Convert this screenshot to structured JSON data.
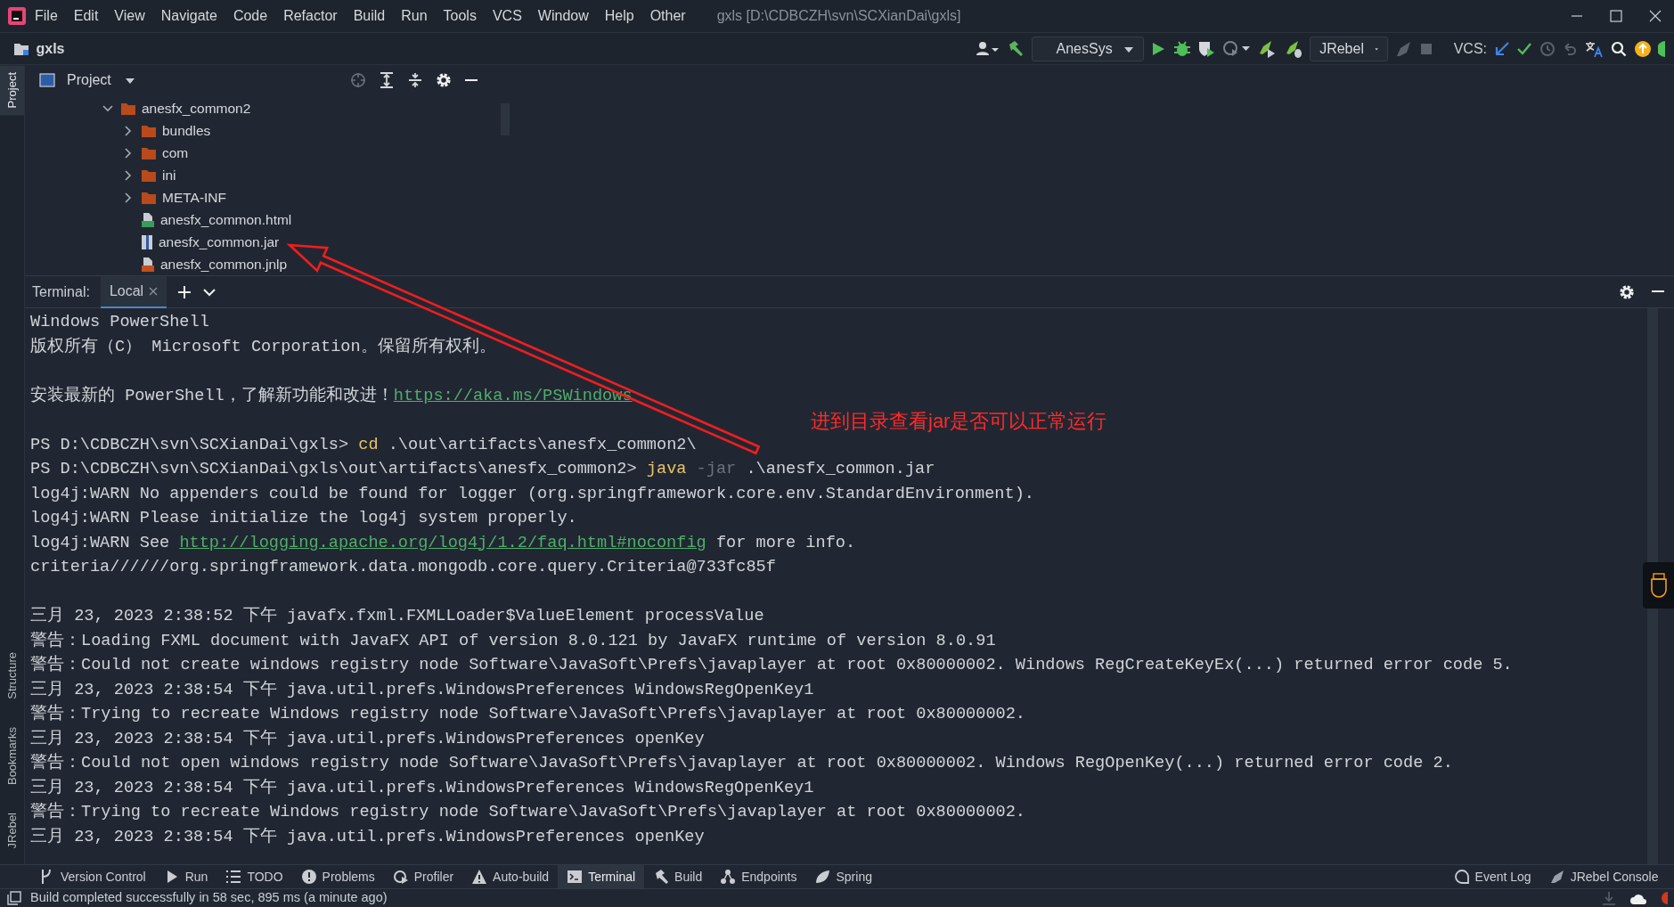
{
  "window": {
    "title": "gxls [D:\\CDBCZH\\svn\\SCXianDai\\gxls]"
  },
  "menu": [
    "File",
    "Edit",
    "View",
    "Navigate",
    "Code",
    "Refactor",
    "Build",
    "Run",
    "Tools",
    "VCS",
    "Window",
    "Help",
    "Other"
  ],
  "toolbar": {
    "project": "gxls",
    "run_config": "AnesSys",
    "jrebel_config": "JRebel",
    "vcs_label": "VCS:"
  },
  "side_tabs_top": [
    {
      "label": "Project",
      "selected": true
    }
  ],
  "side_tabs_bottom": [
    {
      "label": "Structure",
      "selected": false
    },
    {
      "label": "Bookmarks",
      "selected": false
    },
    {
      "label": "JRebel",
      "selected": false
    }
  ],
  "project_panel": {
    "title": "Project",
    "tree": [
      {
        "label": "anesfx_common2",
        "kind": "folder",
        "expanded": true,
        "children": [
          {
            "label": "bundles",
            "kind": "folder",
            "expanded": false
          },
          {
            "label": "com",
            "kind": "folder",
            "expanded": false
          },
          {
            "label": "ini",
            "kind": "folder",
            "expanded": false
          },
          {
            "label": "META-INF",
            "kind": "folder",
            "expanded": false
          },
          {
            "label": "anesfx_common.html",
            "kind": "html"
          },
          {
            "label": "anesfx_common.jar",
            "kind": "jar"
          },
          {
            "label": "anesfx_common.jnlp",
            "kind": "jnlp"
          }
        ]
      }
    ]
  },
  "terminal": {
    "label": "Terminal:",
    "tabs": [
      {
        "label": "Local",
        "selected": true
      }
    ],
    "lines": [
      {
        "segments": [
          {
            "text": "Windows PowerShell",
            "kind": "plain"
          }
        ]
      },
      {
        "segments": [
          {
            "text": "版权所有（C） Microsoft Corporation。保留所有权利。",
            "kind": "plain"
          }
        ]
      },
      {
        "blank_before": true,
        "segments": [
          {
            "text": "安装最新的 PowerShell，了解新功能和改进！",
            "kind": "plain"
          },
          {
            "text": "https://aka.ms/PSWindows",
            "kind": "link"
          }
        ]
      },
      {
        "blank_before": true,
        "segments": [
          {
            "text": "PS D:\\CDBCZH\\svn\\SCXianDai\\gxls> ",
            "kind": "plain"
          },
          {
            "text": "cd",
            "kind": "command"
          },
          {
            "text": " .\\out\\artifacts\\anesfx_common2\\",
            "kind": "plain"
          }
        ]
      },
      {
        "segments": [
          {
            "text": "PS D:\\CDBCZH\\svn\\SCXianDai\\gxls\\out\\artifacts\\anesfx_common2> ",
            "kind": "plain"
          },
          {
            "text": "java",
            "kind": "command"
          },
          {
            "text": " -jar",
            "kind": "flag"
          },
          {
            "text": " .\\anesfx_common.jar",
            "kind": "plain"
          }
        ]
      },
      {
        "segments": [
          {
            "text": "log4j:WARN No appenders could be found for logger (org.springframework.core.env.StandardEnvironment).",
            "kind": "plain"
          }
        ]
      },
      {
        "segments": [
          {
            "text": "log4j:WARN Please initialize the log4j system properly.",
            "kind": "plain"
          }
        ]
      },
      {
        "segments": [
          {
            "text": "log4j:WARN See ",
            "kind": "plain"
          },
          {
            "text": "http://logging.apache.org/log4j/1.2/faq.html#noconfig",
            "kind": "link"
          },
          {
            "text": " for more info.",
            "kind": "plain"
          }
        ]
      },
      {
        "segments": [
          {
            "text": "criteria//////org.springframework.data.mongodb.core.query.Criteria@733fc85f",
            "kind": "plain"
          }
        ]
      },
      {
        "blank_before": true,
        "segments": [
          {
            "text": "三月 23, 2023 2:38:52 下午 javafx.fxml.FXMLLoader$ValueElement processValue",
            "kind": "plain"
          }
        ]
      },
      {
        "segments": [
          {
            "text": "警告：Loading FXML document with JavaFX API of version 8.0.121 by JavaFX runtime of version 8.0.91",
            "kind": "plain"
          }
        ]
      },
      {
        "segments": [
          {
            "text": "警告：Could not create windows registry node Software\\JavaSoft\\Prefs\\javaplayer at root 0x80000002. Windows RegCreateKeyEx(...) returned error code 5.",
            "kind": "plain"
          }
        ]
      },
      {
        "segments": [
          {
            "text": "三月 23, 2023 2:38:54 下午 java.util.prefs.WindowsPreferences WindowsRegOpenKey1",
            "kind": "plain"
          }
        ]
      },
      {
        "segments": [
          {
            "text": "警告：Trying to recreate Windows registry node Software\\JavaSoft\\Prefs\\javaplayer at root 0x80000002.",
            "kind": "plain"
          }
        ]
      },
      {
        "segments": [
          {
            "text": "三月 23, 2023 2:38:54 下午 java.util.prefs.WindowsPreferences openKey",
            "kind": "plain"
          }
        ]
      },
      {
        "segments": [
          {
            "text": "警告：Could not open windows registry node Software\\JavaSoft\\Prefs\\javaplayer at root 0x80000002. Windows RegOpenKey(...) returned error code 2.",
            "kind": "plain"
          }
        ]
      },
      {
        "segments": [
          {
            "text": "三月 23, 2023 2:38:54 下午 java.util.prefs.WindowsPreferences WindowsRegOpenKey1",
            "kind": "plain"
          }
        ]
      },
      {
        "segments": [
          {
            "text": "警告：Trying to recreate Windows registry node Software\\JavaSoft\\Prefs\\javaplayer at root 0x80000002.",
            "kind": "plain"
          }
        ]
      },
      {
        "segments": [
          {
            "text": "三月 23, 2023 2:38:54 下午 java.util.prefs.WindowsPreferences openKey",
            "kind": "plain"
          }
        ]
      }
    ]
  },
  "tool_windows": [
    {
      "label": "Version Control",
      "selected": false
    },
    {
      "label": "Run",
      "selected": false
    },
    {
      "label": "TODO",
      "selected": false
    },
    {
      "label": "Problems",
      "selected": false
    },
    {
      "label": "Profiler",
      "selected": false
    },
    {
      "label": "Auto-build",
      "selected": false
    },
    {
      "label": "Terminal",
      "selected": true
    },
    {
      "label": "Build",
      "selected": false
    },
    {
      "label": "Endpoints",
      "selected": false
    },
    {
      "label": "Spring",
      "selected": false
    }
  ],
  "right_tools": [
    "Event Log",
    "JRebel Console"
  ],
  "status_bar": {
    "message": "Build completed successfully in 58 sec, 895 ms (a minute ago)"
  },
  "annotation": {
    "text": "进到目录查看jar是否可以正常运行"
  }
}
